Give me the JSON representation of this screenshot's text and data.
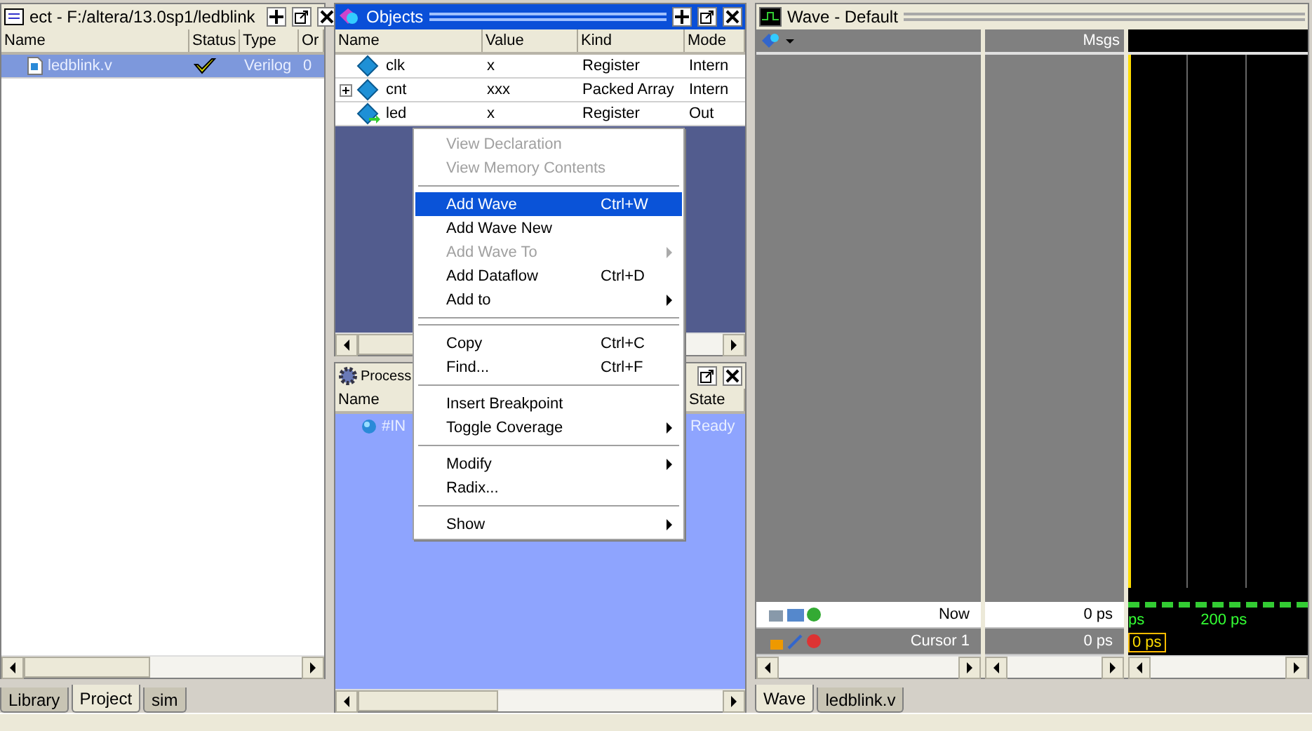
{
  "project_panel": {
    "title": "ect - F:/altera/13.0sp1/ledblink",
    "columns": [
      "Name",
      "Status",
      "Type",
      "Or"
    ],
    "rows": [
      {
        "name": "ledblink.v",
        "type": "Verilog",
        "order": "0",
        "selected": true
      }
    ],
    "tabs": [
      {
        "label": "Library",
        "selected": false
      },
      {
        "label": "Project",
        "selected": true
      },
      {
        "label": "sim",
        "selected": false
      }
    ]
  },
  "objects_panel": {
    "title": "Objects",
    "active": true,
    "columns": [
      "Name",
      "Value",
      "Kind",
      "Mode"
    ],
    "rows": [
      {
        "name": "clk",
        "value": "x",
        "kind_text": "Register",
        "mode": "Intern",
        "expandable": false,
        "kind": "internal"
      },
      {
        "name": "cnt",
        "value": "xxx",
        "kind_text": "Packed Array",
        "mode": "Intern",
        "expandable": true,
        "kind": "internal"
      },
      {
        "name": "led",
        "value": "x",
        "kind_text": "Register",
        "mode": "Out",
        "expandable": false,
        "kind": "output"
      }
    ]
  },
  "processes_panel": {
    "title": "Process",
    "columns": [
      "Name",
      "State"
    ],
    "rows": [
      {
        "name": "#IN",
        "state": "Ready"
      }
    ]
  },
  "context_menu": {
    "items": [
      {
        "kind": "item",
        "label": "View Declaration",
        "disabled": true,
        "selected": false
      },
      {
        "kind": "item",
        "label": "View Memory Contents",
        "disabled": true,
        "selected": false
      },
      {
        "kind": "separator"
      },
      {
        "kind": "item",
        "label": "Add Wave",
        "shortcut": "Ctrl+W",
        "disabled": false,
        "selected": true
      },
      {
        "kind": "item",
        "label": "Add Wave New",
        "disabled": false,
        "selected": false
      },
      {
        "kind": "item",
        "label": "Add Wave To",
        "disabled": true,
        "submenu": true,
        "selected": false
      },
      {
        "kind": "item",
        "label": "Add Dataflow",
        "shortcut": "Ctrl+D",
        "disabled": false,
        "selected": false
      },
      {
        "kind": "item",
        "label": "Add to",
        "disabled": false,
        "submenu": true,
        "selected": false
      },
      {
        "kind": "separator"
      },
      {
        "kind": "separator"
      },
      {
        "kind": "item",
        "label": "Copy",
        "shortcut": "Ctrl+C",
        "disabled": false,
        "selected": false
      },
      {
        "kind": "item",
        "label": "Find...",
        "shortcut": "Ctrl+F",
        "disabled": false,
        "selected": false
      },
      {
        "kind": "separator"
      },
      {
        "kind": "item",
        "label": "Insert Breakpoint",
        "disabled": false,
        "selected": false
      },
      {
        "kind": "item",
        "label": "Toggle Coverage",
        "disabled": false,
        "submenu": true,
        "selected": false
      },
      {
        "kind": "separator"
      },
      {
        "kind": "item",
        "label": "Modify",
        "disabled": false,
        "submenu": true,
        "selected": false
      },
      {
        "kind": "item",
        "label": "Radix...",
        "disabled": false,
        "selected": false
      },
      {
        "kind": "separator"
      },
      {
        "kind": "item",
        "label": "Show",
        "disabled": false,
        "submenu": true,
        "selected": false
      }
    ]
  },
  "wave_panel": {
    "title": "Wave - Default",
    "msgs_header": "Msgs",
    "now_row": {
      "label": "Now",
      "value": "0 ps"
    },
    "cursor_row": {
      "label": "Cursor 1",
      "value": "0 ps",
      "cursor_time": "0 ps"
    },
    "time_labels": [
      "ps",
      "200 ps"
    ],
    "tabs": [
      {
        "label": "Wave",
        "selected": true
      },
      {
        "label": "ledblink.v",
        "selected": false
      }
    ]
  }
}
